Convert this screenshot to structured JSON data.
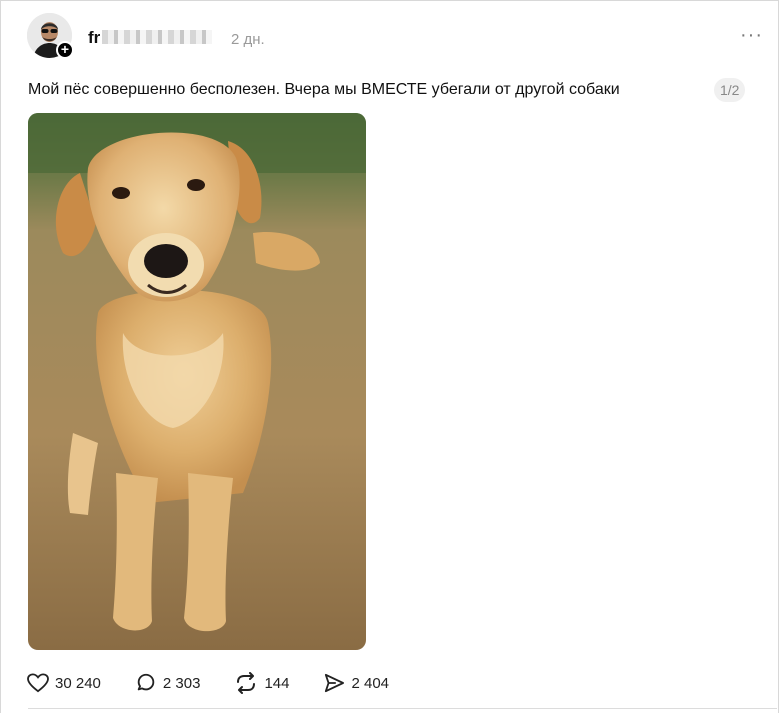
{
  "post": {
    "username": "fr",
    "time": "2 дн.",
    "more_label": "···",
    "text": "Мой пёс совершенно бесполезен. Вчера мы ВМЕСТЕ убегали от другой собаки",
    "page_indicator": "1/2",
    "follow_badge": "+",
    "image": {
      "icon": "golden-retriever-photo"
    }
  },
  "actions": {
    "likes": "30 240",
    "comments": "2 303",
    "reposts": "144",
    "shares": "2 404"
  }
}
